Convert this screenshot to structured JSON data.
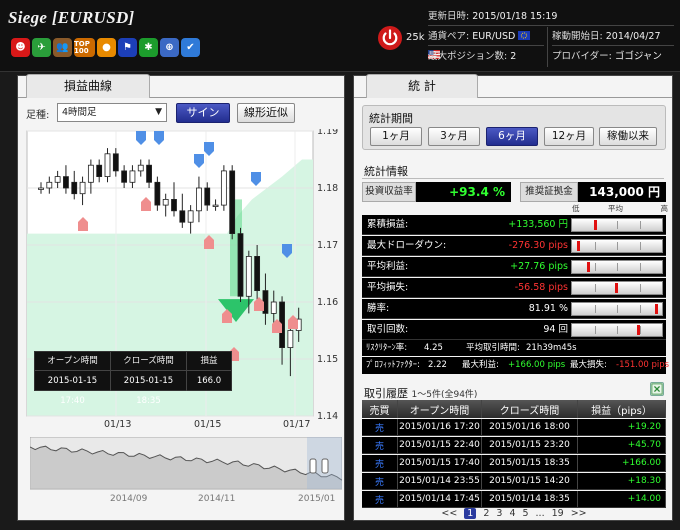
{
  "header": {
    "title": "Siege [EURUSD]",
    "power_count": "25k",
    "badges": [
      {
        "icon": "smile-face-icon",
        "color": "#d81818",
        "glyph": "☻"
      },
      {
        "icon": "rocket-icon",
        "color": "#2a9e3a",
        "glyph": "✈"
      },
      {
        "icon": "group-icon",
        "color": "#8a5a2a",
        "glyph": "👥"
      },
      {
        "icon": "top100-icon",
        "color": "#cc6a00",
        "glyph": "TOP 100"
      },
      {
        "icon": "coin-icon",
        "color": "#e88a00",
        "glyph": "●"
      },
      {
        "icon": "flag-icon",
        "color": "#1c3fb8",
        "glyph": "⚑"
      },
      {
        "icon": "medal-icon",
        "color": "#1c9c2c",
        "glyph": "✱"
      },
      {
        "icon": "compass-icon",
        "color": "#3b69c4",
        "glyph": "⊕"
      },
      {
        "icon": "check-icon",
        "color": "#2f7ad8",
        "glyph": "✔"
      }
    ],
    "info": {
      "updated_label": "更新日時:",
      "updated_value": "2015/01/18 15:19",
      "pair_label": "通貨ペア:",
      "pair_value": "EUR/USD",
      "start_label": "稼動開始日:",
      "start_value": "2014/04/27",
      "maxpos_label": "最大ポジション数:",
      "maxpos_value": "2",
      "provider_label": "プロバイダー:",
      "provider_value": "ゴゴジャン"
    }
  },
  "left": {
    "tab": "損益曲線",
    "timeframe_label": "足種:",
    "timeframe_value": "4時間足",
    "signal_button": "サイン",
    "fit_button": "線形近似",
    "pl_table": {
      "headers": [
        "オープン時間",
        "クローズ時間",
        "損益"
      ],
      "values": [
        "2015-01-15 17:40",
        "2015-01-15 18:35",
        "166.0"
      ]
    }
  },
  "right": {
    "tab": "統 計",
    "period_title": "統計期間",
    "periods": [
      "1ヶ月",
      "3ヶ月",
      "6ヶ月",
      "12ヶ月",
      "稼働以来"
    ],
    "active_period": "6ヶ月",
    "stats_title": "統計情報",
    "roi_label": "投資収益率",
    "roi_value": "+93.4 %",
    "margin_label": "推奨証拠金",
    "margin_value": "143,000 円",
    "range_head": [
      "低",
      "平均",
      "高"
    ],
    "stats": [
      {
        "label": "累積損益:",
        "value": "+133,560 円",
        "tone": "green",
        "marker": 0.26
      },
      {
        "label": "最大ドローダウン:",
        "value": "-276.30 pips",
        "tone": "red",
        "marker": 0.06
      },
      {
        "label": "平均利益:",
        "value": "+27.76 pips",
        "tone": "green",
        "marker": 0.18
      },
      {
        "label": "平均損失:",
        "value": "-56.58 pips",
        "tone": "red",
        "marker": 0.5
      },
      {
        "label": "勝率:",
        "value": "81.91 %",
        "tone": "white",
        "marker": 0.97
      },
      {
        "label": "取引回数:",
        "value": "94 回",
        "tone": "white",
        "marker": 0.76
      }
    ],
    "risk_label": "ﾘｽｸﾘﾀｰﾝ率:",
    "risk_value": "4.25",
    "avg_time_label": "平均取引時間:",
    "avg_time_value": "21h39m45s",
    "pf_label": "ﾌﾟﾛﾌｨｯﾄﾌｧｸﾀｰ:",
    "pf_value": "2.22",
    "max_profit_label": "最大利益:",
    "max_profit_value": "+166.00 pips",
    "max_loss_label": "最大損失:",
    "max_loss_value": "-151.00 pips",
    "history_title": "取引履歴",
    "history_sub": "1～5件(全94件)",
    "history_headers": [
      "売買",
      "オープン時間",
      "クローズ時間",
      "損益（pips）"
    ],
    "history_rows": [
      {
        "side": "売",
        "open": "2015/01/16 17:20",
        "close": "2015/01/16 18:00",
        "pl": "+19.20"
      },
      {
        "side": "売",
        "open": "2015/01/15 22:40",
        "close": "2015/01/15 23:20",
        "pl": "+45.70"
      },
      {
        "side": "売",
        "open": "2015/01/15 17:40",
        "close": "2015/01/15 18:35",
        "pl": "+166.00"
      },
      {
        "side": "売",
        "open": "2015/01/14 23:55",
        "close": "2015/01/15 14:20",
        "pl": "+18.30"
      },
      {
        "side": "売",
        "open": "2015/01/14 17:45",
        "close": "2015/01/14 18:35",
        "pl": "+14.00"
      }
    ],
    "pager": {
      "prev": "<<",
      "pages": [
        "1",
        "2",
        "3",
        "4",
        "5",
        "...",
        "19"
      ],
      "active": "1",
      "next": ">>"
    }
  },
  "chart_data": [
    {
      "type": "candlestick",
      "title": "",
      "x_tick_labels": [
        "01/13",
        "01/15",
        "01/17"
      ],
      "y_tick_labels": [
        "1.19",
        "1.18",
        "1.17",
        "1.16",
        "1.15",
        "1.14"
      ],
      "ylim": [
        1.14,
        1.19
      ],
      "candles": [
        {
          "o": 1.18,
          "h": 1.181,
          "l": 1.179,
          "c": 1.18
        },
        {
          "o": 1.18,
          "h": 1.182,
          "l": 1.179,
          "c": 1.181
        },
        {
          "o": 1.181,
          "h": 1.183,
          "l": 1.18,
          "c": 1.182
        },
        {
          "o": 1.182,
          "h": 1.184,
          "l": 1.179,
          "c": 1.18
        },
        {
          "o": 1.181,
          "h": 1.183,
          "l": 1.178,
          "c": 1.179
        },
        {
          "o": 1.179,
          "h": 1.182,
          "l": 1.177,
          "c": 1.181
        },
        {
          "o": 1.181,
          "h": 1.185,
          "l": 1.179,
          "c": 1.184
        },
        {
          "o": 1.184,
          "h": 1.185,
          "l": 1.181,
          "c": 1.182
        },
        {
          "o": 1.182,
          "h": 1.187,
          "l": 1.181,
          "c": 1.186
        },
        {
          "o": 1.186,
          "h": 1.187,
          "l": 1.182,
          "c": 1.183
        },
        {
          "o": 1.183,
          "h": 1.184,
          "l": 1.18,
          "c": 1.181
        },
        {
          "o": 1.181,
          "h": 1.184,
          "l": 1.18,
          "c": 1.183
        },
        {
          "o": 1.183,
          "h": 1.185,
          "l": 1.182,
          "c": 1.184
        },
        {
          "o": 1.184,
          "h": 1.185,
          "l": 1.18,
          "c": 1.181
        },
        {
          "o": 1.181,
          "h": 1.182,
          "l": 1.176,
          "c": 1.177
        },
        {
          "o": 1.177,
          "h": 1.179,
          "l": 1.175,
          "c": 1.178
        },
        {
          "o": 1.178,
          "h": 1.181,
          "l": 1.175,
          "c": 1.176
        },
        {
          "o": 1.176,
          "h": 1.179,
          "l": 1.173,
          "c": 1.174
        },
        {
          "o": 1.174,
          "h": 1.177,
          "l": 1.172,
          "c": 1.176
        },
        {
          "o": 1.176,
          "h": 1.182,
          "l": 1.174,
          "c": 1.18
        },
        {
          "o": 1.18,
          "h": 1.181,
          "l": 1.176,
          "c": 1.177
        },
        {
          "o": 1.177,
          "h": 1.178,
          "l": 1.176,
          "c": 1.177
        },
        {
          "o": 1.177,
          "h": 1.184,
          "l": 1.176,
          "c": 1.183
        },
        {
          "o": 1.183,
          "h": 1.184,
          "l": 1.171,
          "c": 1.172
        },
        {
          "o": 1.172,
          "h": 1.173,
          "l": 1.16,
          "c": 1.161
        },
        {
          "o": 1.161,
          "h": 1.169,
          "l": 1.158,
          "c": 1.168
        },
        {
          "o": 1.168,
          "h": 1.17,
          "l": 1.16,
          "c": 1.162
        },
        {
          "o": 1.162,
          "h": 1.165,
          "l": 1.156,
          "c": 1.158
        },
        {
          "o": 1.158,
          "h": 1.162,
          "l": 1.156,
          "c": 1.16
        },
        {
          "o": 1.16,
          "h": 1.161,
          "l": 1.149,
          "c": 1.152
        },
        {
          "o": 1.152,
          "h": 1.156,
          "l": 1.147,
          "c": 1.155
        },
        {
          "o": 1.155,
          "h": 1.159,
          "l": 1.153,
          "c": 1.157
        }
      ]
    },
    {
      "type": "area",
      "title": "",
      "x_tick_labels": [
        "2014/09",
        "2014/11",
        "2015/01"
      ],
      "trend": "declining"
    }
  ]
}
